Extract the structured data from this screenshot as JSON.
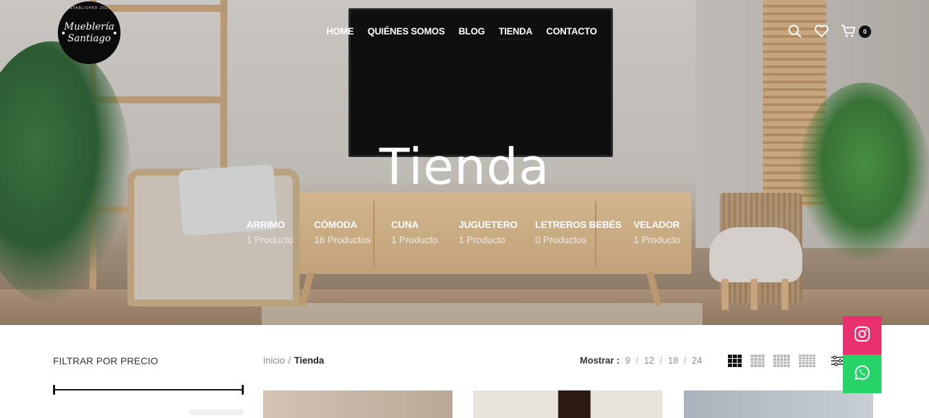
{
  "logo": {
    "established": "ESTABLISHED 2021",
    "line1": "Mueblería",
    "line2": "Santiago"
  },
  "nav": {
    "items": [
      {
        "label": "HOME"
      },
      {
        "label": "QUIÉNES SOMOS"
      },
      {
        "label": "BLOG"
      },
      {
        "label": "TIENDA"
      },
      {
        "label": "CONTACTO"
      }
    ],
    "active": "TIENDA"
  },
  "header_icons": {
    "search": "search-icon",
    "wishlist": "heart-icon",
    "cart": "cart-icon",
    "cart_count": "0"
  },
  "hero": {
    "title": "Tienda"
  },
  "categories": [
    {
      "name": "ARRIMO",
      "count": "1 Producto"
    },
    {
      "name": "CÓMODA",
      "count": "16 Productos"
    },
    {
      "name": "CUNA",
      "count": "1 Producto"
    },
    {
      "name": "JUGUETERO",
      "count": "1 Producto"
    },
    {
      "name": "LETREROS BEBÉS",
      "count": "0 Productos"
    },
    {
      "name": "VELADOR",
      "count": "1 Producto"
    }
  ],
  "sidebar": {
    "filter_title": "FILTRAR POR PRECIO"
  },
  "breadcrumb": {
    "home": "Inicio",
    "separator": "/",
    "current": "Tienda"
  },
  "toolbar": {
    "show_label": "Mostrar :",
    "show_options": [
      "9",
      "12",
      "18",
      "24"
    ],
    "separator": "/",
    "view_modes": [
      "grid-2",
      "grid-3",
      "grid-4",
      "grid-5"
    ],
    "active_view": "grid-2"
  },
  "social": {
    "instagram": "instagram-icon",
    "whatsapp": "whatsapp-icon"
  },
  "colors": {
    "instagram": "#e8316e",
    "whatsapp": "#25d366",
    "text_dark": "#222222",
    "muted": "#8a8a8a"
  }
}
